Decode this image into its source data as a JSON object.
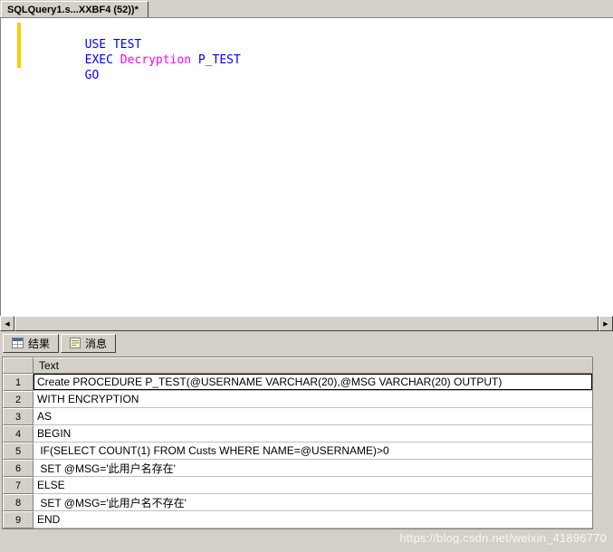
{
  "window": {
    "tab_title": "SQLQuery1.s...XXBF4 (52))*"
  },
  "colors": {
    "window_background": "#d4d0c8",
    "editor_background": "#ffffff",
    "change_bar_yellow": "#f2d000",
    "keyword_blue": "#0000ff",
    "proc_magenta": "#ff00ff",
    "grid_line_silver": "#c0c0c0"
  },
  "editor": {
    "lines": [
      {
        "tokens": [
          {
            "text": "USE ",
            "color": "#0000ff"
          },
          {
            "text": "TEST",
            "color": "#0000ff"
          }
        ]
      },
      {
        "tokens": [
          {
            "text": "EXEC ",
            "color": "#0000ff"
          },
          {
            "text": "Decryption ",
            "color": "#ff00ff"
          },
          {
            "text": "P_TEST",
            "color": "#0000ff"
          }
        ]
      },
      {
        "tokens": [
          {
            "text": "GO",
            "color": "#0000ff"
          }
        ]
      }
    ]
  },
  "scrollbar": {
    "left_glyph": "◀",
    "right_glyph": "▶"
  },
  "results_pane": {
    "tabs": [
      {
        "label": "结果"
      },
      {
        "label": "消息"
      }
    ]
  },
  "results": {
    "column_header": "Text",
    "rows": [
      {
        "num": "1",
        "text": "Create PROCEDURE P_TEST(@USERNAME VARCHAR(20),@MSG VARCHAR(20) OUTPUT)"
      },
      {
        "num": "2",
        "text": "WITH ENCRYPTION"
      },
      {
        "num": "3",
        "text": "AS"
      },
      {
        "num": "4",
        "text": "BEGIN"
      },
      {
        "num": "5",
        "text": " IF(SELECT COUNT(1) FROM Custs WHERE NAME=@USERNAME)>0"
      },
      {
        "num": "6",
        "text": " SET @MSG='此用户名存在'"
      },
      {
        "num": "7",
        "text": "ELSE"
      },
      {
        "num": "8",
        "text": " SET @MSG='此用户名不存在'"
      },
      {
        "num": "9",
        "text": "END"
      }
    ]
  },
  "watermark": "https://blog.csdn.net/weixin_41896770"
}
